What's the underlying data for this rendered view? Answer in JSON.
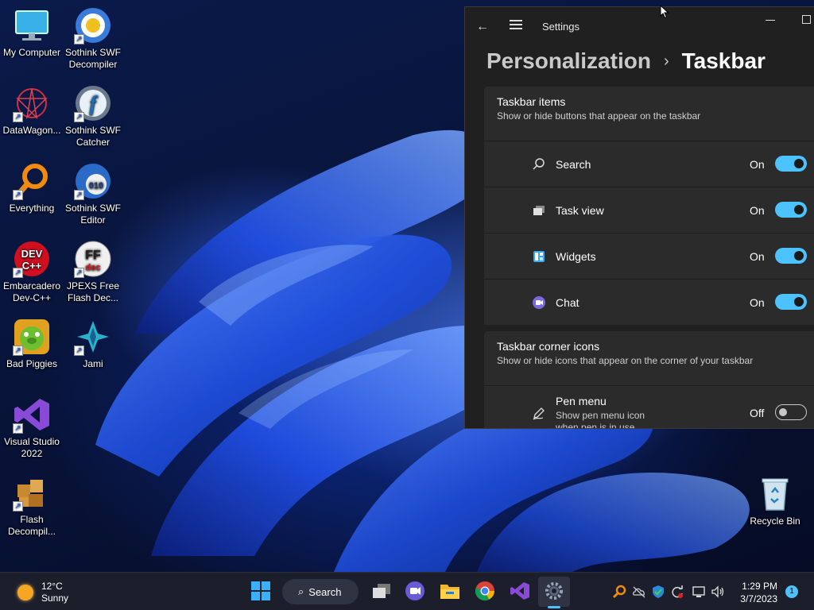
{
  "desktop_icons": [
    {
      "label": "My Computer",
      "icon": "monitor-icon"
    },
    {
      "label": "Sothink SWF Decompiler",
      "icon": "sothink-decompiler-icon"
    },
    {
      "label": "DataWagon...",
      "icon": "datawagon-icon"
    },
    {
      "label": "Sothink SWF Catcher",
      "icon": "sothink-catcher-icon"
    },
    {
      "label": "Everything",
      "icon": "everything-search-icon"
    },
    {
      "label": "Sothink SWF Editor",
      "icon": "sothink-editor-icon"
    },
    {
      "label": "Embarcadero Dev-C++",
      "icon": "devcpp-icon"
    },
    {
      "label": "JPEXS Free Flash Dec...",
      "icon": "jpexs-icon"
    },
    {
      "label": "Bad Piggies",
      "icon": "bad-piggies-icon"
    },
    {
      "label": "Jami",
      "icon": "jami-icon"
    },
    {
      "label": "Visual Studio 2022",
      "icon": "visual-studio-icon"
    },
    {
      "label": "Flash Decompil...",
      "icon": "flash-decompiler-icon"
    }
  ],
  "recycle_bin": {
    "label": "Recycle Bin",
    "icon": "recycle-bin-icon"
  },
  "settings": {
    "window_title": "Settings",
    "breadcrumb_parent": "Personalization",
    "breadcrumb_separator": "›",
    "breadcrumb_current": "Taskbar",
    "taskbar_items": {
      "title": "Taskbar items",
      "subtitle": "Show or hide buttons that appear on the taskbar",
      "rows": [
        {
          "label": "Search",
          "state": "On",
          "on": true,
          "icon": "search-icon"
        },
        {
          "label": "Task view",
          "state": "On",
          "on": true,
          "icon": "task-view-icon"
        },
        {
          "label": "Widgets",
          "state": "On",
          "on": true,
          "icon": "widgets-icon"
        },
        {
          "label": "Chat",
          "state": "On",
          "on": true,
          "icon": "chat-icon"
        }
      ]
    },
    "corner_icons": {
      "title": "Taskbar corner icons",
      "subtitle": "Show or hide icons that appear on the corner of your taskbar",
      "rows": [
        {
          "label": "Pen menu",
          "description": "Show pen menu icon when pen is in use",
          "state": "Off",
          "on": false,
          "icon": "pen-icon"
        }
      ]
    },
    "accent_color": "#4cc2ff"
  },
  "taskbar": {
    "weather": {
      "temp": "12°C",
      "condition": "Sunny"
    },
    "search_label": "Search",
    "apps": [
      "start-icon",
      "task-view-icon",
      "chat-icon",
      "file-explorer-icon",
      "chrome-icon",
      "visual-studio-icon",
      "settings-gear-icon"
    ],
    "tray": [
      "everything-search-icon",
      "onedrive-icon",
      "security-icon",
      "sync-icon",
      "display-icon",
      "volume-icon"
    ],
    "clock": {
      "time": "1:29 PM",
      "date": "3/7/2023"
    },
    "notification_count": "1"
  }
}
